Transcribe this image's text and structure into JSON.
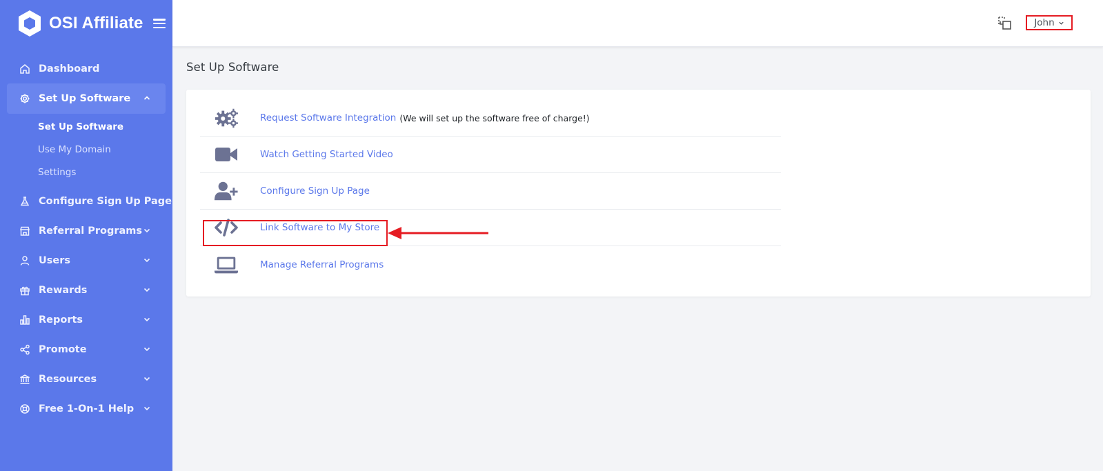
{
  "brand": {
    "name": "OSI Affiliate"
  },
  "sidebar": {
    "items": [
      {
        "label": "Dashboard",
        "icon": "home-icon"
      },
      {
        "label": "Set Up Software",
        "icon": "gear-icon",
        "expanded": true,
        "children": [
          {
            "label": "Set Up Software",
            "current": true
          },
          {
            "label": "Use My Domain"
          },
          {
            "label": "Settings"
          }
        ]
      },
      {
        "label": "Configure Sign Up Page",
        "icon": "flask-icon"
      },
      {
        "label": "Referral Programs",
        "icon": "store-icon"
      },
      {
        "label": "Users",
        "icon": "user-icon"
      },
      {
        "label": "Rewards",
        "icon": "gift-icon"
      },
      {
        "label": "Reports",
        "icon": "bar-chart-icon"
      },
      {
        "label": "Promote",
        "icon": "share-icon"
      },
      {
        "label": "Resources",
        "icon": "bank-icon"
      },
      {
        "label": "Free 1-On-1 Help",
        "icon": "lifebuoy-icon"
      }
    ]
  },
  "header": {
    "user_name": "John"
  },
  "page": {
    "title": "Set Up Software",
    "actions": [
      {
        "label": "Request Software Integration",
        "note": "(We will set up the software free of charge!)",
        "icon": "gears-icon"
      },
      {
        "label": "Watch Getting Started Video",
        "icon": "video-camera-icon"
      },
      {
        "label": "Configure Sign Up Page",
        "icon": "user-plus-icon"
      },
      {
        "label": "Link Software to My Store",
        "icon": "code-icon"
      },
      {
        "label": "Manage Referral Programs",
        "icon": "laptop-icon"
      }
    ]
  },
  "colors": {
    "sidebar": "#5b78ea",
    "link": "#5b78ea",
    "annotation": "#e51c23",
    "icon": "#6c7293"
  }
}
